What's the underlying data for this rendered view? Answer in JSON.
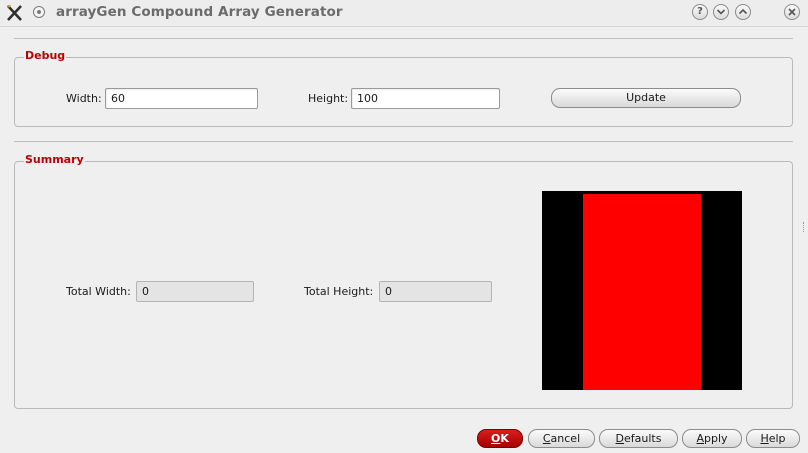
{
  "window": {
    "title": "arrayGen Compound Array Generator",
    "controls": {
      "help": "?",
      "minimize": "v",
      "maximize": "^"
    }
  },
  "debug": {
    "legend": "Debug",
    "width_label": "Width:",
    "width_value": "60",
    "height_label": "Height:",
    "height_value": "100",
    "update_label": "Update"
  },
  "summary": {
    "legend": "Summary",
    "total_width_label": "Total Width:",
    "total_width_value": "0",
    "total_height_label": "Total Height:",
    "total_height_value": "0",
    "preview": {
      "background": "#000000",
      "array_color": "#ff0000"
    }
  },
  "buttons": {
    "ok": {
      "accel": "O",
      "rest": "K"
    },
    "cancel": {
      "accel": "C",
      "rest": "ancel"
    },
    "defaults": {
      "accel": "D",
      "rest": "efaults"
    },
    "apply": {
      "accel": "A",
      "rest": "pply"
    },
    "help": {
      "accel": "H",
      "rest": "elp"
    }
  },
  "colors": {
    "accent": "#c00000",
    "ok_button": "#c00000"
  }
}
